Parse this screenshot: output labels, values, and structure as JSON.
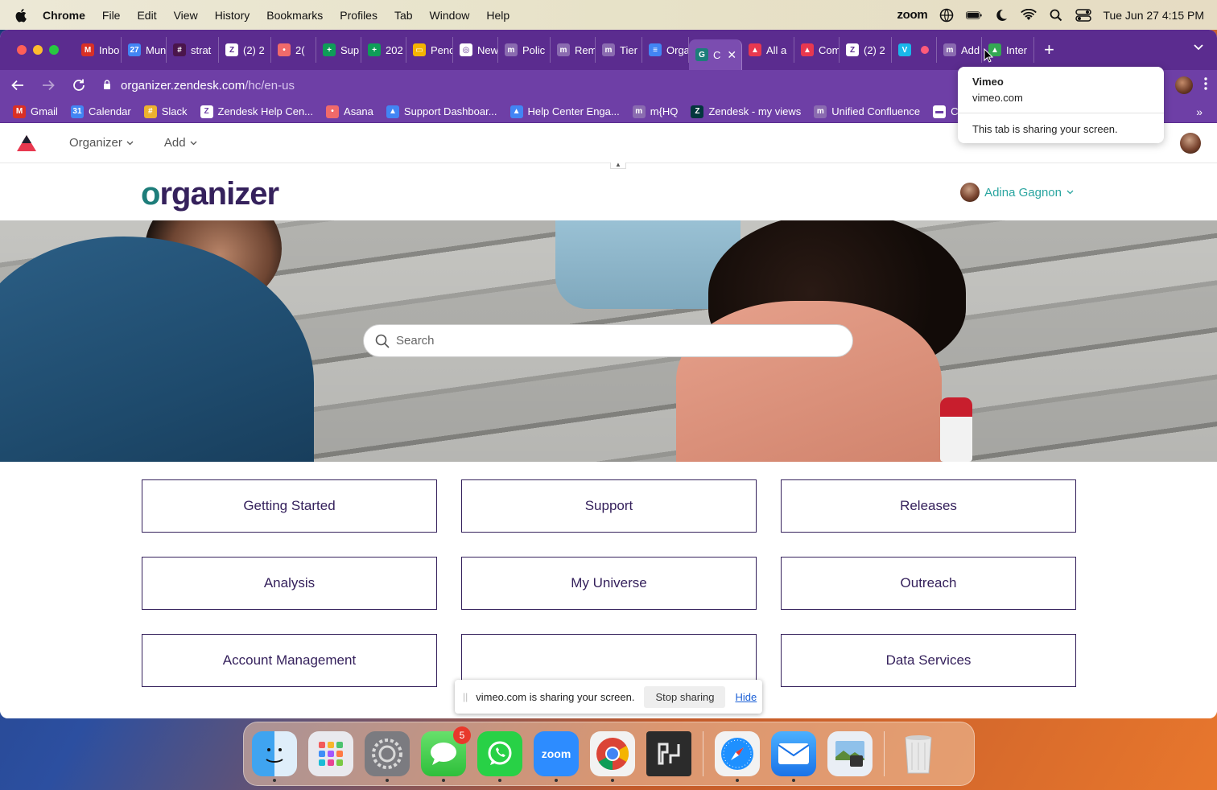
{
  "menubar": {
    "app": "Chrome",
    "items": [
      "File",
      "Edit",
      "View",
      "History",
      "Bookmarks",
      "Profiles",
      "Tab",
      "Window",
      "Help"
    ],
    "zoom_label": "zoom",
    "datetime": "Tue Jun 27  4:15 PM"
  },
  "tabs": [
    {
      "label": "Inbo",
      "icon": "gmail-icon",
      "color": "#d93025",
      "glyph": "M"
    },
    {
      "label": "Mun",
      "icon": "calendar-icon",
      "color": "#4285f4",
      "glyph": "27"
    },
    {
      "label": "strat",
      "icon": "slack-icon",
      "color": "#4a154b",
      "glyph": "#"
    },
    {
      "label": "(2) 2",
      "icon": "zendesk-icon",
      "color": "#ffffff",
      "glyph": "Z"
    },
    {
      "label": "2(",
      "icon": "asana-icon",
      "color": "#f06a6a",
      "glyph": "•"
    },
    {
      "label": "Sup",
      "icon": "sheets-icon",
      "color": "#0f9d58",
      "glyph": "+"
    },
    {
      "label": "202",
      "icon": "sheets-icon",
      "color": "#0f9d58",
      "glyph": "+"
    },
    {
      "label": "Penc",
      "icon": "slides-icon",
      "color": "#f4b400",
      "glyph": "▭"
    },
    {
      "label": "New",
      "icon": "chrome-icon",
      "color": "#ffffff",
      "glyph": "◎"
    },
    {
      "label": "Polic",
      "icon": "m-icon",
      "color": "#8a6bb0",
      "glyph": "m"
    },
    {
      "label": "Rem",
      "icon": "m-icon",
      "color": "#8a6bb0",
      "glyph": "m"
    },
    {
      "label": "Tier",
      "icon": "m-icon",
      "color": "#8a6bb0",
      "glyph": "m"
    },
    {
      "label": "Orga",
      "icon": "docs-icon",
      "color": "#4285f4",
      "glyph": "≡"
    },
    {
      "label": "C",
      "icon": "organizer-icon",
      "color": "#1d7d7a",
      "glyph": "G",
      "active": true
    },
    {
      "label": "All a",
      "icon": "zd-triangle-icon",
      "color": "#e8384f",
      "glyph": "▲"
    },
    {
      "label": "Com",
      "icon": "zd-triangle-icon",
      "color": "#e8384f",
      "glyph": "▲"
    },
    {
      "label": "(2) 2",
      "icon": "zendesk-icon",
      "color": "#ffffff",
      "glyph": "Z"
    },
    {
      "label": "",
      "icon": "vimeo-icon",
      "color": "#1ab7ea",
      "glyph": "V"
    },
    {
      "label": "Add",
      "icon": "m-icon",
      "color": "#8a6bb0",
      "glyph": "m"
    },
    {
      "label": "Inter",
      "icon": "drive-icon",
      "color": "#34a853",
      "glyph": "▲"
    }
  ],
  "address": {
    "host": "organizer.zendesk.com",
    "path": "/hc/en-us"
  },
  "bookmarks": [
    {
      "label": "Gmail",
      "icon": "gmail-icon",
      "color": "#d93025",
      "glyph": "M"
    },
    {
      "label": "Calendar",
      "icon": "calendar-icon",
      "color": "#4285f4",
      "glyph": "31"
    },
    {
      "label": "Slack",
      "icon": "slack-icon",
      "color": "#ecb22e",
      "glyph": "#"
    },
    {
      "label": "Zendesk Help Cen...",
      "icon": "zendesk-icon",
      "color": "#ffffff",
      "glyph": "Z"
    },
    {
      "label": "Asana",
      "icon": "asana-icon",
      "color": "#f06a6a",
      "glyph": "•"
    },
    {
      "label": "Support Dashboar...",
      "icon": "triangle-icon",
      "color": "#4285f4",
      "glyph": "▲"
    },
    {
      "label": "Help Center Enga...",
      "icon": "triangle-icon",
      "color": "#4285f4",
      "glyph": "▲"
    },
    {
      "label": "m{HQ",
      "icon": "m-icon",
      "color": "#8a6bb0",
      "glyph": "m"
    },
    {
      "label": "Zendesk - my views",
      "icon": "zendesk-z-icon",
      "color": "#03363d",
      "glyph": "Z"
    },
    {
      "label": "Unified Confluence",
      "icon": "m-icon",
      "color": "#8a6bb0",
      "glyph": "m"
    },
    {
      "label": "C",
      "icon": "bookmark-icon",
      "color": "#ffffff",
      "glyph": "▬"
    }
  ],
  "tooltip": {
    "title": "Vimeo",
    "domain": "vimeo.com",
    "message": "This tab is sharing your screen."
  },
  "zd_nav": {
    "organizer": "Organizer",
    "add": "Add"
  },
  "hc": {
    "logo_o": "o",
    "logo_rest": "rganizer",
    "user_name": "Adina Gagnon"
  },
  "search": {
    "placeholder": "Search"
  },
  "categories": [
    "Getting Started",
    "Support",
    "Releases",
    "Analysis",
    "My Universe",
    "Outreach",
    "Account Management",
    "",
    "Data Services"
  ],
  "share_bar": {
    "message": "vimeo.com is sharing your screen.",
    "stop": "Stop sharing",
    "hide": "Hide"
  },
  "dock": {
    "messages_badge": "5",
    "zoom_label": "zoom"
  }
}
